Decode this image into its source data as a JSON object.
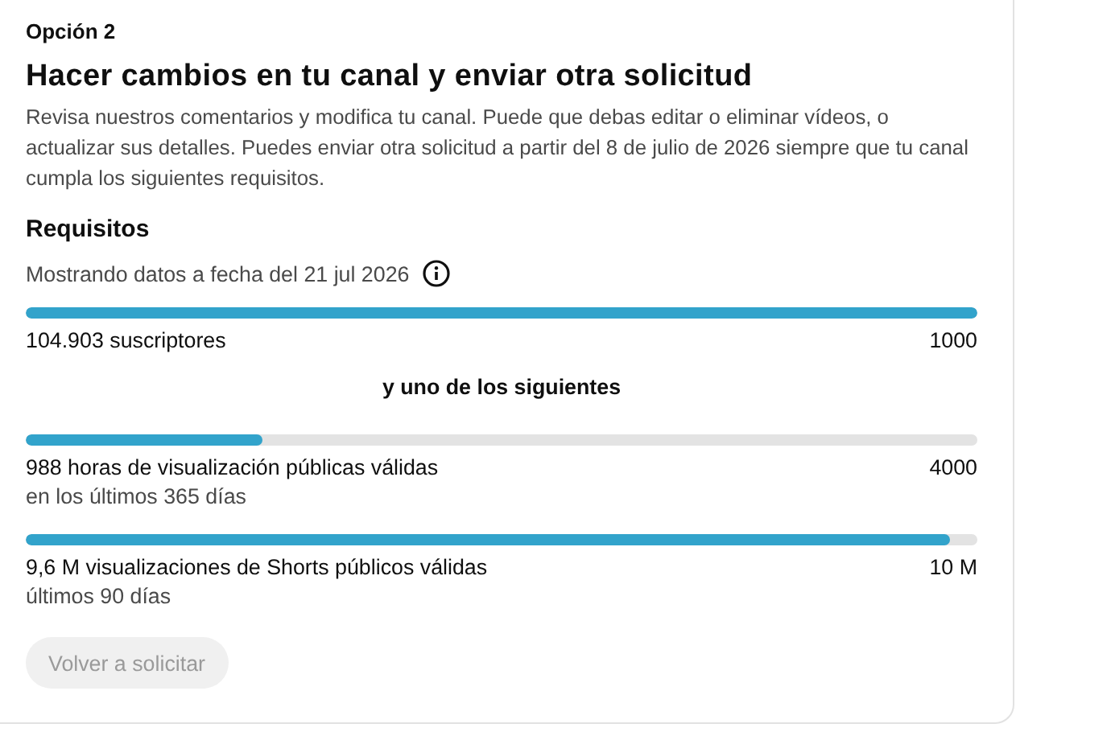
{
  "option_label": "Opción 2",
  "title": "Hacer cambios en tu canal y enviar otra solicitud",
  "description": "Revisa nuestros comentarios y modifica tu canal. Puede que debas editar o eliminar vídeos, o actualizar sus detalles. Puedes enviar otra solicitud a partir del 8 de julio de 2026 siempre que tu canal cumpla los siguientes requisitos.",
  "requirements": {
    "title": "Requisitos",
    "as_of": "Mostrando datos a fecha del 21 jul 2026",
    "metrics": [
      {
        "kind": "main",
        "level": 1,
        "label": "104.903 suscriptores",
        "target": "1000"
      },
      {
        "kind": "separator",
        "label": "y uno de los siguientes"
      },
      {
        "kind": "sub",
        "level": 0.248,
        "label": "988 horas de visualización públicas válidas",
        "sublabel": "en los últimos 365 días",
        "target": "4000"
      },
      {
        "kind": "sub",
        "level": 0.972,
        "label": "9,6 M visualizaciones de Shorts públicos válidas",
        "sublabel": "últimos 90 días",
        "target": "10 M"
      }
    ]
  },
  "button": {
    "label": "Volver a solicitar",
    "disabled": true
  }
}
